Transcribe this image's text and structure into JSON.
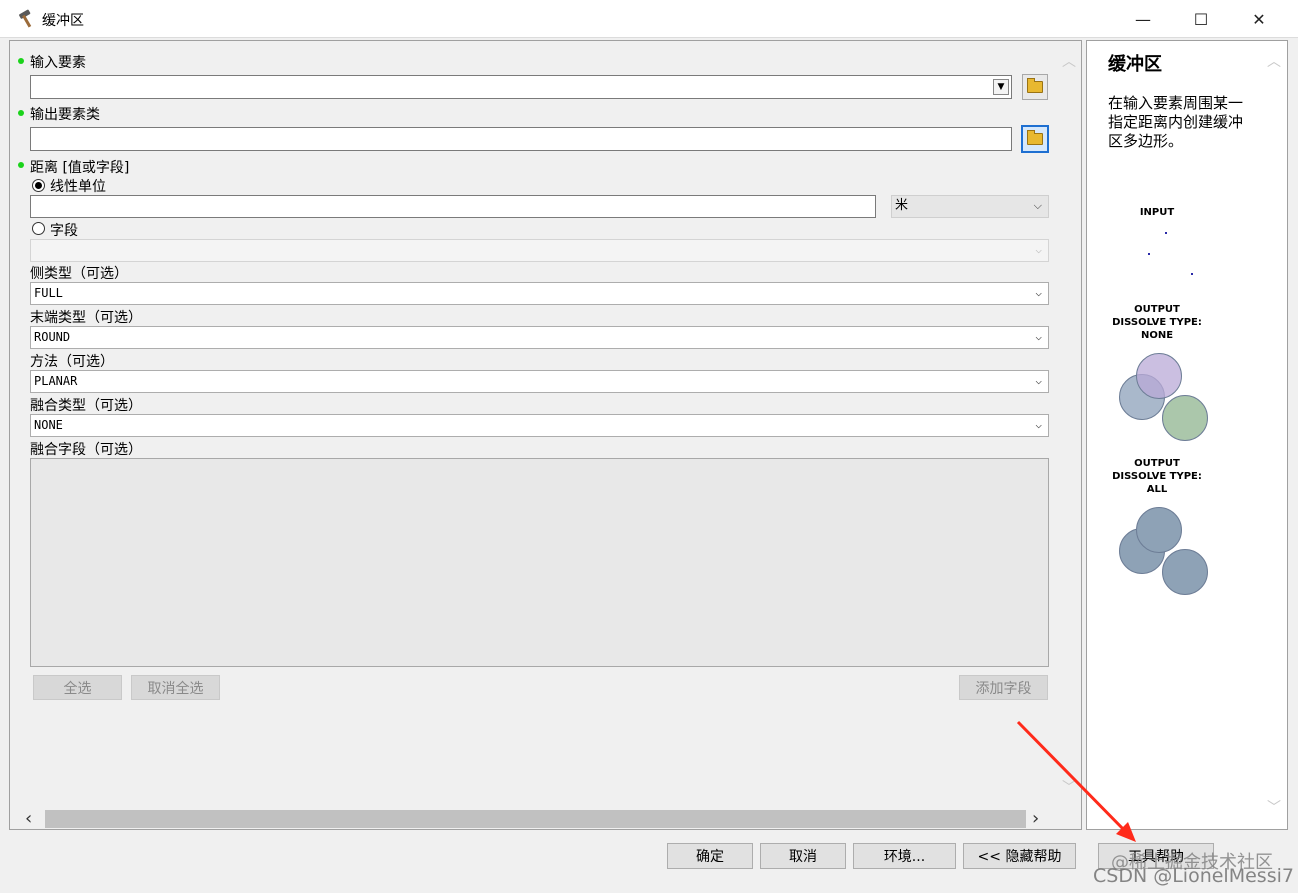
{
  "window": {
    "title": "缓冲区",
    "minimize": "—",
    "maximize": "☐",
    "close": "✕"
  },
  "form": {
    "input_features": {
      "label": "输入要素",
      "value": ""
    },
    "output_features": {
      "label": "输出要素类",
      "value": ""
    },
    "distance": {
      "label": "距离 [值或字段]",
      "linear_unit": {
        "label": "线性单位",
        "selected": true,
        "value": "",
        "unit": "米"
      },
      "field": {
        "label": "字段",
        "selected": false,
        "value": ""
      }
    },
    "side_type": {
      "label": "侧类型（可选）",
      "value": "FULL"
    },
    "end_type": {
      "label": "末端类型（可选）",
      "value": "ROUND"
    },
    "method": {
      "label": "方法（可选）",
      "value": "PLANAR"
    },
    "dissolve_type": {
      "label": "融合类型（可选）",
      "value": "NONE"
    },
    "dissolve_field": {
      "label": "融合字段（可选）"
    },
    "select_all": "全选",
    "deselect_all": "取消全选",
    "add_field": "添加字段"
  },
  "help": {
    "title": "缓冲区",
    "description": "在输入要素周围某一指定距离内创建缓冲区多边形。",
    "input_caption": "INPUT",
    "output_none_caption_1": "OUTPUT",
    "output_none_caption_2": "DISSOLVE TYPE:",
    "output_none_caption_3": "NONE",
    "output_all_caption_1": "OUTPUT",
    "output_all_caption_2": "DISSOLVE TYPE:",
    "output_all_caption_3": "ALL"
  },
  "buttons": {
    "ok": "确定",
    "cancel": "取消",
    "environments": "环境...",
    "hide_help": "<< 隐藏帮助",
    "tool_help": "工具帮助"
  },
  "watermark": "CSDN @LionelMessi7",
  "watermark2": "@稀土掘金技术社区",
  "colors": {
    "required_bullet": "#1bd31b",
    "annotation_arrow": "#ff2a1a",
    "focus_border": "#1e6fd1"
  }
}
